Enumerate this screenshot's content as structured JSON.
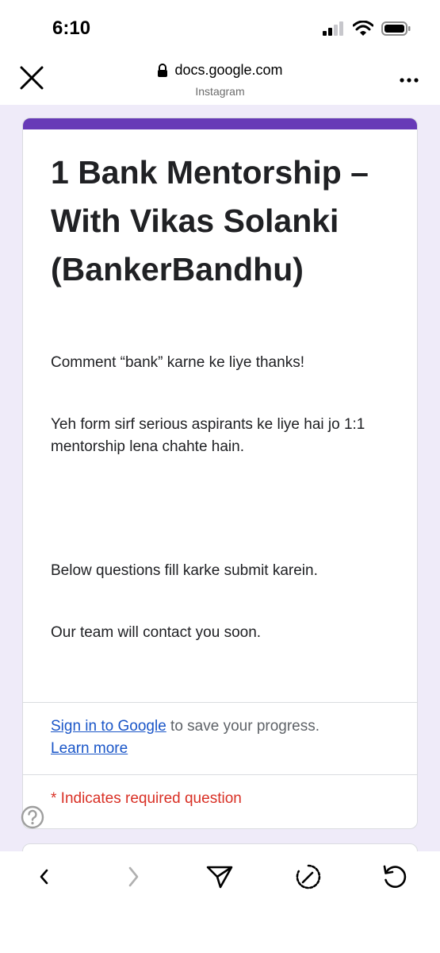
{
  "status_bar": {
    "time": "6:10",
    "icons": [
      "cellular-signal-icon",
      "wifi-icon",
      "battery-icon"
    ]
  },
  "browser": {
    "domain": "docs.google.com",
    "source": "Instagram",
    "icons": [
      "close-icon",
      "lock-icon",
      "more-icon"
    ]
  },
  "form": {
    "accent_color": "#673ab7",
    "title": "1 Bank Mentorship – With Vikas Solanki (BankerBandhu)",
    "description": {
      "line1": "Comment “bank” karne ke liye thanks!",
      "line2": "Yeh form sirf serious aspirants ke liye hai jo 1:1 mentorship lena chahte hain.",
      "line3": "Below questions fill karke submit karein.",
      "line4": "Our team will contact you soon."
    },
    "signin": {
      "link": "Sign in to Google",
      "text": " to save your progress.",
      "learn_more": "Learn more"
    },
    "required_note": "* Indicates required question",
    "help_icon": "help-icon"
  },
  "bottom_nav": {
    "icons": [
      "back-icon",
      "forward-icon",
      "share-icon",
      "speed-icon",
      "refresh-icon"
    ]
  }
}
